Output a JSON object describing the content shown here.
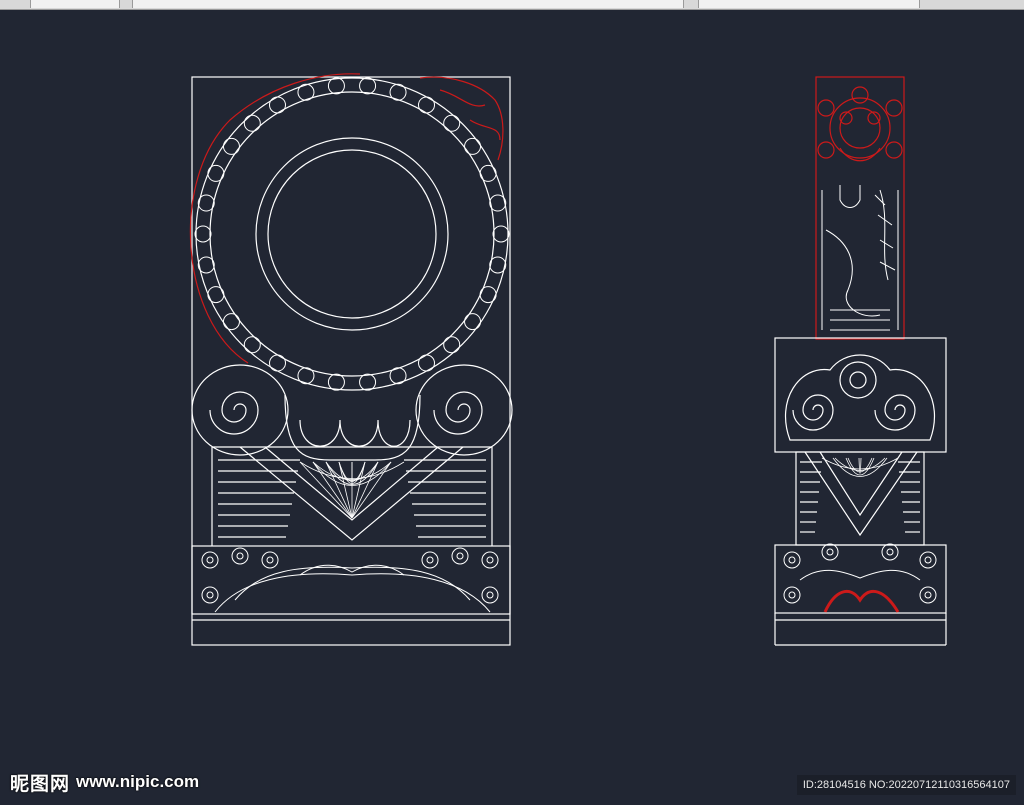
{
  "window": {
    "background": "#212633",
    "line_color": "#ffffff",
    "accent_line_color": "#cc1a1a"
  },
  "drawing": {
    "left_figure": "drum-stone-front-elevation",
    "right_figure": "drum-stone-side-elevation"
  },
  "watermark": {
    "logo_text": "昵图网",
    "url_text": "www.nipic.com"
  },
  "id_strip": {
    "text": "ID:28104516 NO:20220712110316564107"
  }
}
